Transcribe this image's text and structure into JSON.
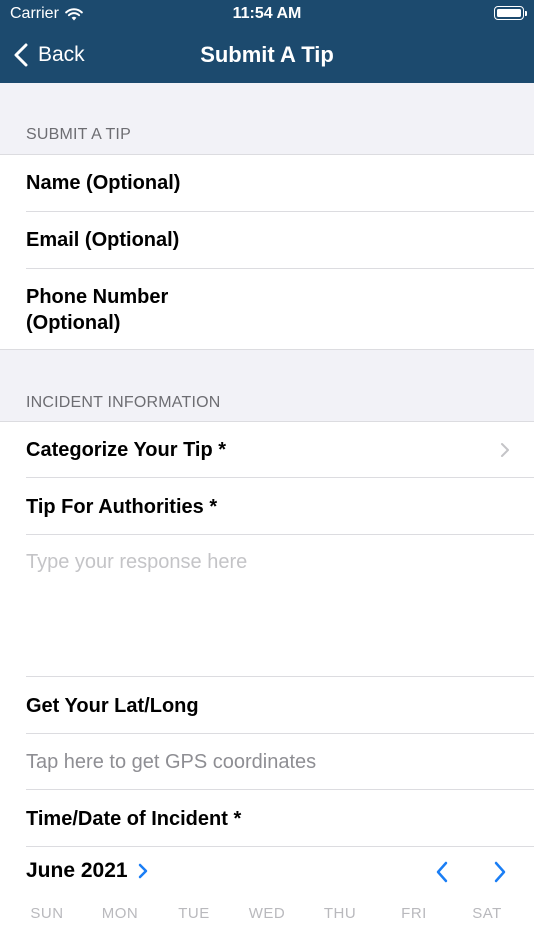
{
  "status_bar": {
    "carrier": "Carrier",
    "time": "11:54 AM"
  },
  "nav": {
    "back_label": "Back",
    "title": "Submit A Tip"
  },
  "sections": {
    "submit_header": "SUBMIT A TIP",
    "incident_header": "INCIDENT INFORMATION"
  },
  "fields": {
    "name_label": "Name (Optional)",
    "email_label": "Email (Optional)",
    "phone_label_line1": "Phone Number",
    "phone_label_line2": "(Optional)",
    "category_label": "Categorize Your Tip *",
    "tip_label": "Tip For Authorities *",
    "tip_placeholder": "Type your response here",
    "latlong_label": "Get Your Lat/Long",
    "gps_hint": "Tap here to get GPS coordinates",
    "datetime_label": "Time/Date of Incident *"
  },
  "calendar": {
    "month_label": "June 2021",
    "weekdays": [
      "SUN",
      "MON",
      "TUE",
      "WED",
      "THU",
      "FRI",
      "SAT"
    ],
    "accent_color": "#1a7ef5"
  }
}
